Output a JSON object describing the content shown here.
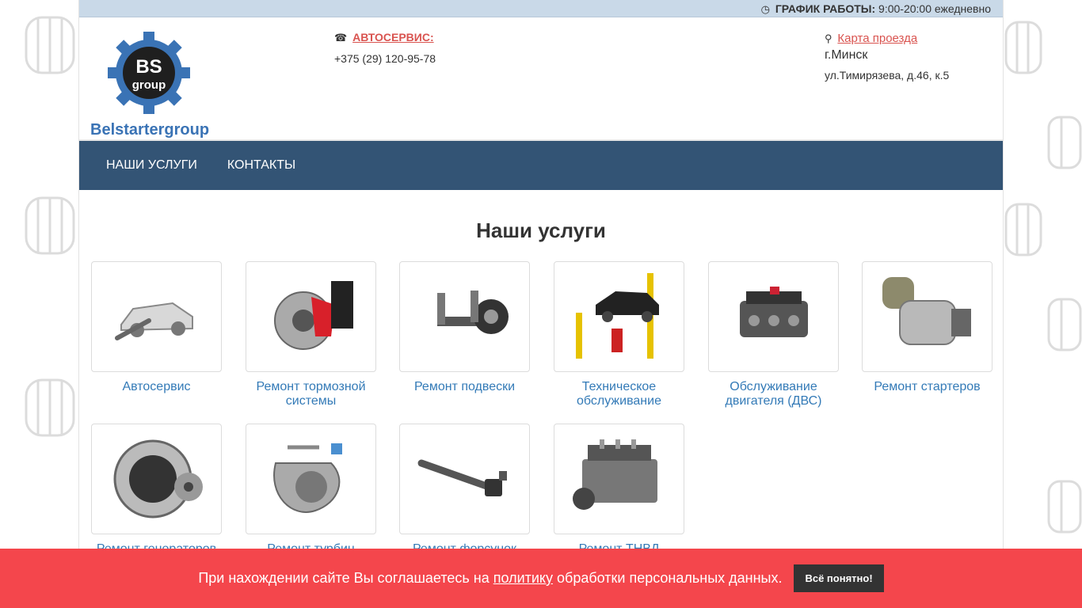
{
  "topbar": {
    "schedule_label": "ГРАФИК РАБОТЫ:",
    "schedule_value": "9:00-20:00 ежедневно",
    "icon": "clock-icon"
  },
  "logo": {
    "badge_top": "BS",
    "badge_bottom": "group",
    "name": "Belstartergroup"
  },
  "contacts": {
    "phone_label": "АВТОСЕРВИС:",
    "phone": "+375 (29) 120-95-78",
    "map_link": "Карта проезда",
    "city": "г.Минск",
    "street": "ул.Тимирязева, д.46, к.5"
  },
  "nav": {
    "items": [
      "НАШИ УСЛУГИ",
      "КОНТАКТЫ"
    ]
  },
  "main": {
    "title": "Наши услуги"
  },
  "services": [
    {
      "label": "Автосервис",
      "icon": "car-service-icon"
    },
    {
      "label": "Ремонт тормозной системы",
      "icon": "brake-icon"
    },
    {
      "label": "Ремонт подвески",
      "icon": "suspension-icon"
    },
    {
      "label": "Техническое обслуживание",
      "icon": "car-lift-icon"
    },
    {
      "label": "Обслуживание двигателя (ДВС)",
      "icon": "engine-icon"
    },
    {
      "label": "Ремонт стартеров",
      "icon": "starter-icon"
    },
    {
      "label": "Ремонт генераторов",
      "icon": "alternator-icon"
    },
    {
      "label": "Ремонт турбин",
      "icon": "turbo-icon"
    },
    {
      "label": "Ремонт форсунок",
      "icon": "injector-icon"
    },
    {
      "label": "Ремонт ТНВД",
      "icon": "fuel-pump-icon"
    }
  ],
  "cookie": {
    "text_before": "При нахождении сайте Вы соглашаетесь на",
    "link": "политику",
    "text_after": "обработки персональных данных.",
    "button": "Всё понятно!"
  },
  "colors": {
    "nav_bg": "#335475",
    "topbar_bg": "#c9d9e8",
    "link": "#337ab7",
    "cookie_bg": "#f4464c",
    "accent_red": "#d9534f"
  }
}
